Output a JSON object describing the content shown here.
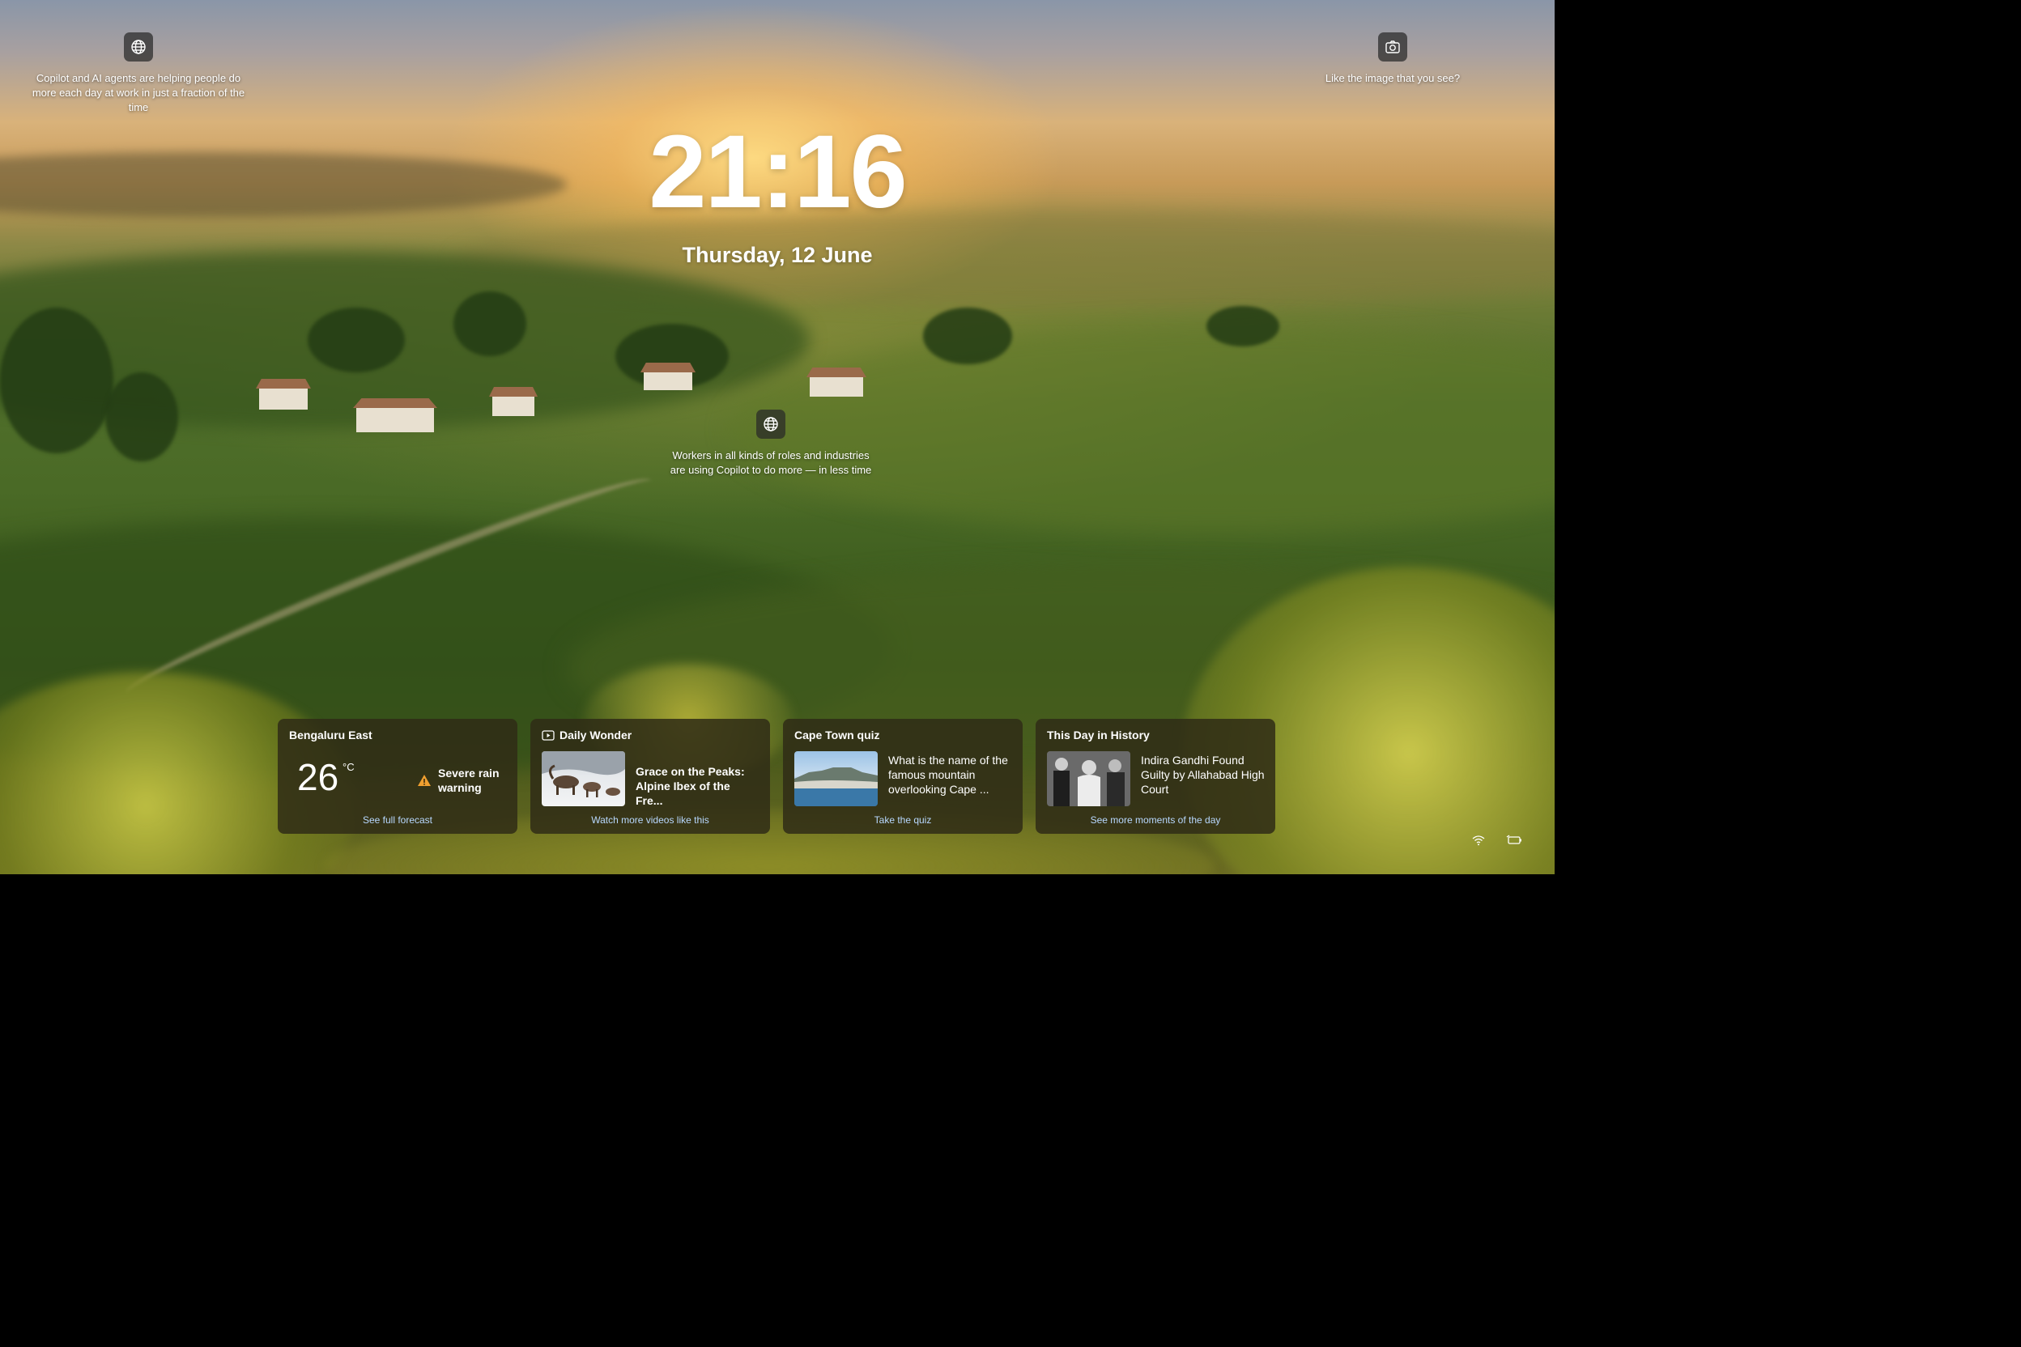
{
  "spotlight_left": {
    "icon": "globe-icon",
    "text": "Copilot and AI agents are helping people do more each day at work in just a fraction of the time"
  },
  "spotlight_right": {
    "icon": "camera-icon",
    "text": "Like the image that you see?"
  },
  "spotlight_center": {
    "icon": "globe-icon",
    "text": "Workers in all kinds of roles and industries are using Copilot to do more — in less time"
  },
  "lock": {
    "time": "21:16",
    "date": "Thursday, 12 June"
  },
  "widgets": {
    "weather": {
      "location": "Bengaluru East",
      "temperature": "26",
      "unit": "°C",
      "alert": "Severe rain warning",
      "link": "See full forecast",
      "alert_color": "#f0a030"
    },
    "daily_wonder": {
      "title": "Daily Wonder",
      "icon": "video-icon",
      "headline": "Grace on the Peaks: Alpine Ibex of the Fre...",
      "link": "Watch more videos like this"
    },
    "quiz": {
      "title": "Cape Town quiz",
      "question": "What is the name of the famous mountain overlooking Cape ...",
      "link": "Take the quiz"
    },
    "history": {
      "title": "This Day in History",
      "headline": "Indira Gandhi Found Guilty by Allahabad High Court",
      "link": "See more moments of the day"
    }
  },
  "tray": {
    "icons": [
      "wifi-icon",
      "battery-icon"
    ]
  },
  "colors": {
    "link": "#b8d8ff",
    "card_bg": "rgba(48,44,22,0.86)"
  }
}
